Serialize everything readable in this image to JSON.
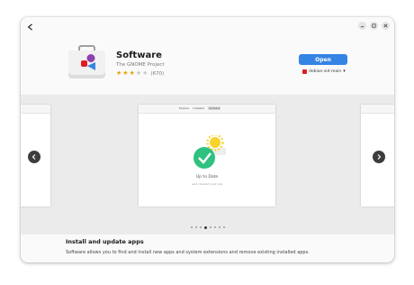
{
  "header": {
    "back_icon": "back-arrow-icon",
    "window_controls": [
      "minimize-icon",
      "maximize-icon",
      "close-icon"
    ]
  },
  "app": {
    "name": "Software",
    "developer": "The GNOME Project",
    "rating_stars": 3,
    "rating_max": 5,
    "rating_count": "(670)",
    "open_label": "Open",
    "source_label": "debian-sid-main",
    "accent": "#3584e4"
  },
  "screenshots": {
    "main": {
      "tabs": [
        "Explore",
        "Installed",
        "Updates"
      ],
      "active_tab": "Updates",
      "title": "Up to Date",
      "subtitle": "Last checked: just now"
    },
    "dots_count": 8,
    "active_dot": 3
  },
  "description": {
    "title": "Install and update apps",
    "text": "Software allows you to find and install new apps and system extensions and remove existing installed apps."
  }
}
